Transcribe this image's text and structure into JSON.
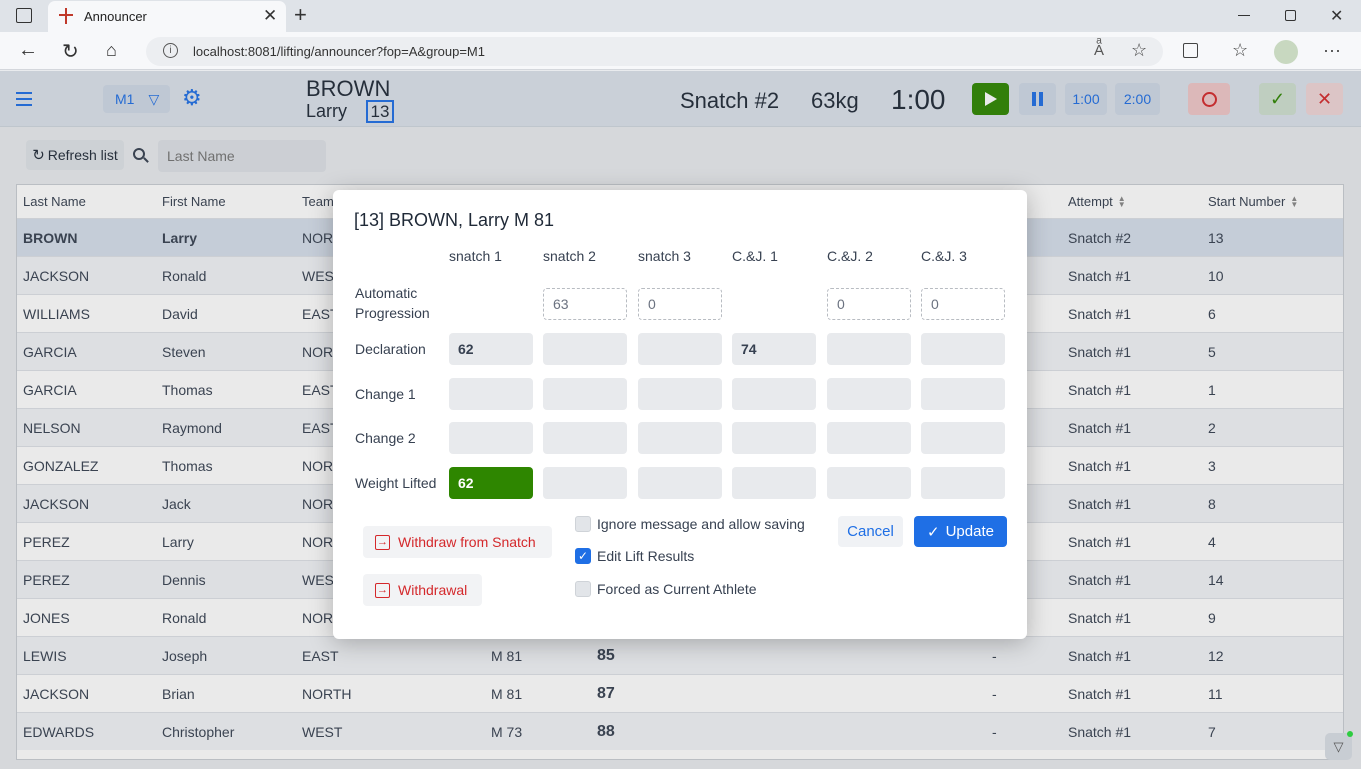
{
  "browser": {
    "tab_title": "Announcer",
    "url": "localhost:8081/lifting/announcer?fop=A&group=M1"
  },
  "header": {
    "group": "M1",
    "athlete_last": "BROWN",
    "athlete_first": "Larry",
    "start_number": "13",
    "attempt": "Snatch #2",
    "weight": "63kg",
    "clock": "1:00",
    "btn_1min": "1:00",
    "btn_2min": "2:00"
  },
  "toolbar": {
    "refresh_label": "Refresh list",
    "search_placeholder": "Last Name"
  },
  "grid": {
    "headers": {
      "last_name": "Last Name",
      "first_name": "First Name",
      "team": "Team",
      "attempt": "Attempt",
      "start_number": "Start Number"
    },
    "rows": [
      {
        "last": "BROWN",
        "first": "Larry",
        "team": "NORTH",
        "cat": "",
        "total": "",
        "dash": "",
        "attempt": "Snatch #2",
        "start": "13"
      },
      {
        "last": "JACKSON",
        "first": "Ronald",
        "team": "WEST",
        "cat": "",
        "total": "",
        "dash": "",
        "attempt": "Snatch #1",
        "start": "10"
      },
      {
        "last": "WILLIAMS",
        "first": "David",
        "team": "EAST",
        "cat": "",
        "total": "",
        "dash": "",
        "attempt": "Snatch #1",
        "start": "6"
      },
      {
        "last": "GARCIA",
        "first": "Steven",
        "team": "NORTH",
        "cat": "",
        "total": "",
        "dash": "",
        "attempt": "Snatch #1",
        "start": "5"
      },
      {
        "last": "GARCIA",
        "first": "Thomas",
        "team": "EAST",
        "cat": "",
        "total": "",
        "dash": "",
        "attempt": "Snatch #1",
        "start": "1"
      },
      {
        "last": "NELSON",
        "first": "Raymond",
        "team": "EAST",
        "cat": "",
        "total": "",
        "dash": "",
        "attempt": "Snatch #1",
        "start": "2"
      },
      {
        "last": "GONZALEZ",
        "first": "Thomas",
        "team": "NORTH",
        "cat": "",
        "total": "",
        "dash": "",
        "attempt": "Snatch #1",
        "start": "3"
      },
      {
        "last": "JACKSON",
        "first": "Jack",
        "team": "NORTH",
        "cat": "",
        "total": "",
        "dash": "",
        "attempt": "Snatch #1",
        "start": "8"
      },
      {
        "last": "PEREZ",
        "first": "Larry",
        "team": "NORTH",
        "cat": "",
        "total": "",
        "dash": "",
        "attempt": "Snatch #1",
        "start": "4"
      },
      {
        "last": "PEREZ",
        "first": "Dennis",
        "team": "WEST",
        "cat": "",
        "total": "",
        "dash": "",
        "attempt": "Snatch #1",
        "start": "14"
      },
      {
        "last": "JONES",
        "first": "Ronald",
        "team": "NORTH",
        "cat": "",
        "total": "",
        "dash": "",
        "attempt": "Snatch #1",
        "start": "9"
      },
      {
        "last": "LEWIS",
        "first": "Joseph",
        "team": "EAST",
        "cat": "M 81",
        "total": "85",
        "dash": "-",
        "attempt": "Snatch #1",
        "start": "12"
      },
      {
        "last": "JACKSON",
        "first": "Brian",
        "team": "NORTH",
        "cat": "M 81",
        "total": "87",
        "dash": "-",
        "attempt": "Snatch #1",
        "start": "11"
      },
      {
        "last": "EDWARDS",
        "first": "Christopher",
        "team": "WEST",
        "cat": "M 73",
        "total": "88",
        "dash": "-",
        "attempt": "Snatch #1",
        "start": "7"
      }
    ]
  },
  "dialog": {
    "title": "[13] BROWN, Larry M 81",
    "columns": [
      "snatch 1",
      "snatch 2",
      "snatch 3",
      "C.&J. 1",
      "C.&J. 2",
      "C.&J. 3"
    ],
    "rows": [
      {
        "label": "Automatic Progression",
        "cells": [
          "",
          "63",
          "0",
          "",
          "0",
          "0"
        ]
      },
      {
        "label": "Declaration",
        "cells": [
          "62",
          "",
          "",
          "74",
          "",
          ""
        ]
      },
      {
        "label": "Change 1",
        "cells": [
          "",
          "",
          "",
          "",
          "",
          ""
        ]
      },
      {
        "label": "Change 2",
        "cells": [
          "",
          "",
          "",
          "",
          "",
          ""
        ]
      },
      {
        "label": "Weight Lifted",
        "cells": [
          "62",
          "",
          "",
          "",
          "",
          ""
        ]
      }
    ],
    "withdraw_snatch": "Withdraw from Snatch",
    "withdrawal": "Withdrawal",
    "cb_ignore": "Ignore message and allow saving",
    "cb_edit": "Edit Lift Results",
    "cb_forced": "Forced as Current Athlete",
    "cancel": "Cancel",
    "update": "Update"
  },
  "colors": {
    "accent": "#1f6fe5",
    "success": "#2e8600",
    "danger": "#d4282b"
  }
}
